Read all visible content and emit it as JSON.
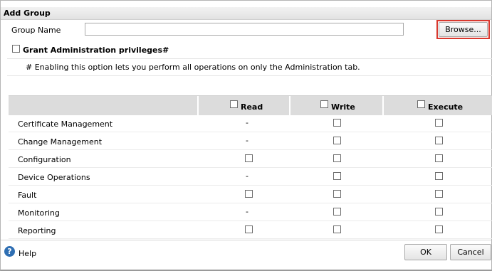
{
  "dialog": {
    "title": "Add Group"
  },
  "form": {
    "group_name_label": "Group Name",
    "group_name_value": "",
    "browse_label": "Browse...",
    "grant_admin_label": "Grant Administration privileges#",
    "grant_admin_note": "# Enabling this option lets you perform all operations on only the Administration tab."
  },
  "table": {
    "columns": [
      "Read",
      "Write",
      "Execute"
    ],
    "rows": [
      {
        "name": "Certificate Management",
        "read": "-",
        "write": "checkbox",
        "execute": "checkbox"
      },
      {
        "name": "Change Management",
        "read": "-",
        "write": "checkbox",
        "execute": "checkbox"
      },
      {
        "name": "Configuration",
        "read": "checkbox",
        "write": "checkbox",
        "execute": "checkbox"
      },
      {
        "name": "Device Operations",
        "read": "-",
        "write": "checkbox",
        "execute": "checkbox"
      },
      {
        "name": "Fault",
        "read": "checkbox",
        "write": "checkbox",
        "execute": "checkbox"
      },
      {
        "name": "Monitoring",
        "read": "-",
        "write": "checkbox",
        "execute": "checkbox"
      },
      {
        "name": "Reporting",
        "read": "checkbox",
        "write": "checkbox",
        "execute": "checkbox"
      }
    ]
  },
  "footer": {
    "help_label": "Help",
    "ok_label": "OK",
    "cancel_label": "Cancel"
  },
  "colors": {
    "highlight": "#d9392f",
    "help_icon": "#2f6fb3"
  }
}
